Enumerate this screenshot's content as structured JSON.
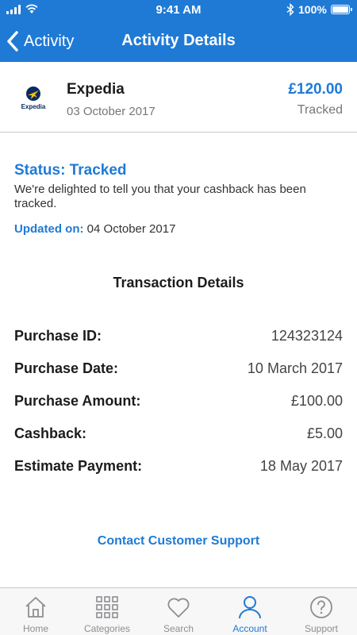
{
  "status_bar": {
    "time": "9:41 AM",
    "battery_percent": "100%",
    "icons": [
      "signal-icon",
      "wifi-icon",
      "bluetooth-icon",
      "battery-icon"
    ]
  },
  "nav": {
    "back_label": "Activity",
    "back_icon": "chevron-left-icon",
    "title": "Activity Details"
  },
  "merchant": {
    "name": "Expedia",
    "logo_text": "Expedia",
    "date": "03 October 2017",
    "amount": "£120.00",
    "state": "Tracked"
  },
  "status": {
    "title": "Status: Tracked",
    "message": "We're delighted to tell you that your cashback has been tracked.",
    "updated_label": "Updated on:",
    "updated_date": "04 October 2017"
  },
  "transaction": {
    "heading": "Transaction Details",
    "rows": [
      {
        "label": "Purchase ID:",
        "value": "124323124"
      },
      {
        "label": "Purchase Date:",
        "value": "10 March 2017"
      },
      {
        "label": "Purchase Amount:",
        "value": "£100.00"
      },
      {
        "label": "Cashback:",
        "value": "£5.00"
      },
      {
        "label": "Estimate Payment:",
        "value": "18 May 2017"
      }
    ]
  },
  "contact_label": "Contact Customer Support",
  "tabs": [
    {
      "label": "Home",
      "icon": "home-icon",
      "active": false
    },
    {
      "label": "Categories",
      "icon": "grid-icon",
      "active": false
    },
    {
      "label": "Search",
      "icon": "heart-icon",
      "active": false
    },
    {
      "label": "Account",
      "icon": "user-icon",
      "active": true
    },
    {
      "label": "Support",
      "icon": "help-icon",
      "active": false
    }
  ],
  "colors": {
    "brand": "#1f7ad6",
    "inactive_tab": "#8e8e93"
  }
}
